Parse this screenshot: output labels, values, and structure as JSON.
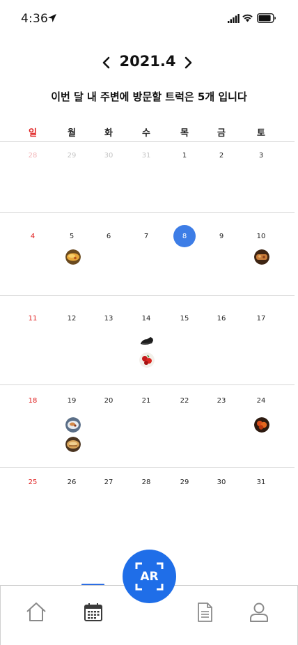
{
  "status_bar": {
    "time": "4:36"
  },
  "header": {
    "month_title": "2021.4",
    "summary": "이번 달 내 주변에 방문할 트럭은 5개 입니다"
  },
  "weekdays": [
    "일",
    "월",
    "화",
    "수",
    "목",
    "금",
    "토"
  ],
  "calendar": {
    "weeks": [
      [
        {
          "day": "28",
          "muted": true
        },
        {
          "day": "29",
          "muted": true
        },
        {
          "day": "30",
          "muted": true
        },
        {
          "day": "31",
          "muted": true
        },
        {
          "day": "1"
        },
        {
          "day": "2"
        },
        {
          "day": "3"
        }
      ],
      [
        {
          "day": "4"
        },
        {
          "day": "5",
          "trucks": [
            "food-truck-1"
          ]
        },
        {
          "day": "6"
        },
        {
          "day": "7"
        },
        {
          "day": "8",
          "selected": true
        },
        {
          "day": "9"
        },
        {
          "day": "10",
          "trucks": [
            "food-truck-2"
          ]
        }
      ],
      [
        {
          "day": "11"
        },
        {
          "day": "12"
        },
        {
          "day": "13"
        },
        {
          "day": "14",
          "trucks": [
            "food-truck-3",
            "food-truck-4"
          ]
        },
        {
          "day": "15"
        },
        {
          "day": "16"
        },
        {
          "day": "17"
        }
      ],
      [
        {
          "day": "18"
        },
        {
          "day": "19",
          "trucks": [
            "food-truck-5",
            "food-truck-6"
          ]
        },
        {
          "day": "20"
        },
        {
          "day": "21"
        },
        {
          "day": "22"
        },
        {
          "day": "23"
        },
        {
          "day": "24",
          "trucks": [
            "food-truck-7"
          ]
        }
      ],
      [
        {
          "day": "25"
        },
        {
          "day": "26"
        },
        {
          "day": "27"
        },
        {
          "day": "28"
        },
        {
          "day": "29"
        },
        {
          "day": "30"
        },
        {
          "day": "31"
        }
      ]
    ]
  },
  "ar_button": {
    "label": "AR"
  },
  "tab_bar": {
    "items": [
      "home-icon",
      "calendar-icon",
      "document-icon",
      "profile-icon"
    ],
    "active": "calendar-icon"
  },
  "colors": {
    "accent": "#3d7de6",
    "ar_button": "#1f6ee8",
    "sunday": "#e02020"
  }
}
